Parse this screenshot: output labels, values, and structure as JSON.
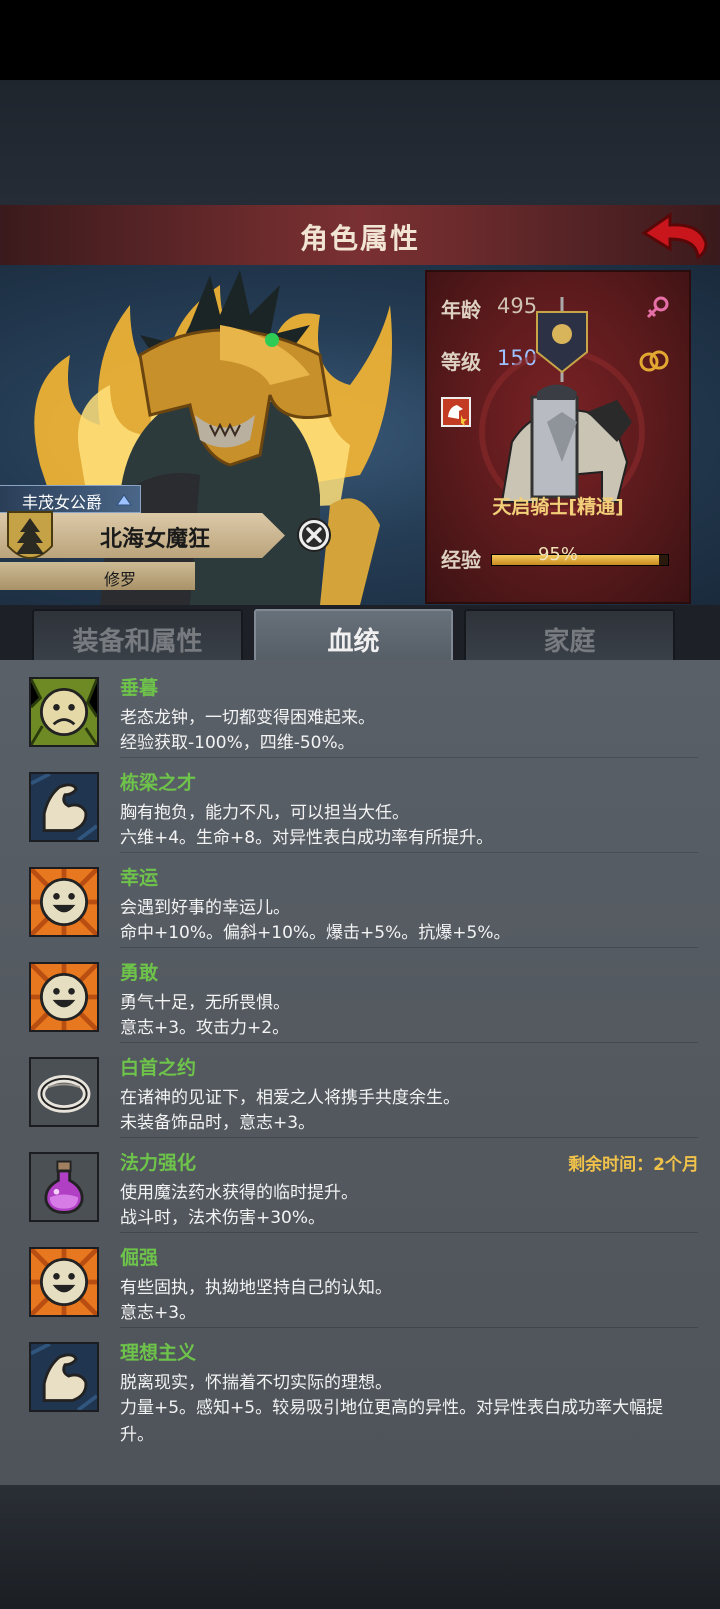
{
  "header": {
    "title": "角色属性",
    "back_icon": "red-back-arrow-icon"
  },
  "character": {
    "title_badge": "丰茂女公爵",
    "name": "北海女魔狂",
    "class": "修罗",
    "emblem_icon": "pine-tree-crest-icon"
  },
  "stats": {
    "age_label": "年龄",
    "age_value": "495",
    "level_label": "等级",
    "level_value": "150",
    "gender_icon": "female-icon",
    "ring_icon": "wedding-rings-icon",
    "mount_name": "天启骑士[精通]",
    "exp_label": "经验",
    "exp_value": "95%",
    "exp_fraction": 0.95,
    "accent": "#9ec1ff"
  },
  "tabs": [
    {
      "label": "装备和属性",
      "active": false
    },
    {
      "label": "血统",
      "active": true
    },
    {
      "label": "家庭",
      "active": false
    }
  ],
  "traits": [
    {
      "icon": "sad-face-icon",
      "name": "垂暮",
      "line1": "老态龙钟，一切都变得困难起来。",
      "line2": "经验获取-100%，四维-50%。",
      "remaining": ""
    },
    {
      "icon": "flexed-arm-icon",
      "name": "栋梁之才",
      "line1": "胸有抱负，能力不凡，可以担当大任。",
      "line2": "六维+4。生命+8。对异性表白成功率有所提升。",
      "remaining": ""
    },
    {
      "icon": "happy-face-icon",
      "name": "幸运",
      "line1": "会遇到好事的幸运儿。",
      "line2": "命中+10%。偏斜+10%。爆击+5%。抗爆+5%。",
      "remaining": ""
    },
    {
      "icon": "happy-face-icon",
      "name": "勇敢",
      "line1": "勇气十足，无所畏惧。",
      "line2": "意志+3。攻击力+2。",
      "remaining": ""
    },
    {
      "icon": "ring-icon",
      "name": "白首之约",
      "line1": "在诸神的见证下，相爱之人将携手共度余生。",
      "line2": "未装备饰品时，意志+3。",
      "remaining": ""
    },
    {
      "icon": "potion-icon",
      "name": "法力强化",
      "line1": "使用魔法药水获得的临时提升。",
      "line2": "战斗时，法术伤害+30%。",
      "remaining": "剩余时间：2个月"
    },
    {
      "icon": "happy-face-icon",
      "name": "倔强",
      "line1": "有些固执，执拗地坚持自己的认知。",
      "line2": "意志+3。",
      "remaining": ""
    },
    {
      "icon": "flexed-arm-icon",
      "name": "理想主义",
      "line1": "脱离现实，怀揣着不切实际的理想。",
      "line2": "力量+5。感知+5。较易吸引地位更高的异性。对异性表白成功率大幅提升。",
      "remaining": ""
    }
  ]
}
